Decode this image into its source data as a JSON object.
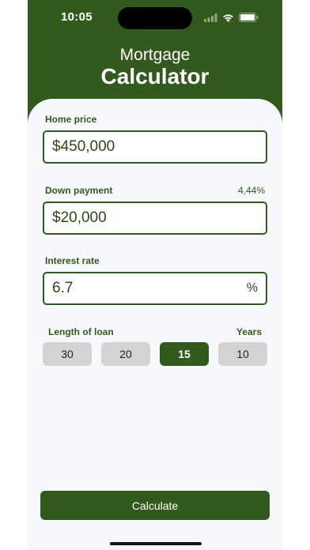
{
  "status_bar": {
    "time": "10:05",
    "icons": [
      "signal-icon",
      "wifi-icon",
      "battery-icon"
    ]
  },
  "header": {
    "title_line1": "Mortgage",
    "title_line2": "Calculator"
  },
  "form": {
    "home_price": {
      "label": "Home price",
      "value": "$450,000"
    },
    "down_payment": {
      "label": "Down payment",
      "percent": "4,44%",
      "value": "$20,000"
    },
    "interest_rate": {
      "label": "Interest rate",
      "value": "6.7",
      "suffix": "%"
    },
    "loan_length": {
      "label": "Length of loan",
      "unit_label": "Years",
      "options": [
        "30",
        "20",
        "15",
        "10"
      ],
      "selected": "15"
    }
  },
  "actions": {
    "calculate_label": "Calculate"
  },
  "colors": {
    "brand_green": "#335a1d",
    "sheet_background": "#f7f8fc",
    "unselected_button": "#d3d3d3"
  }
}
